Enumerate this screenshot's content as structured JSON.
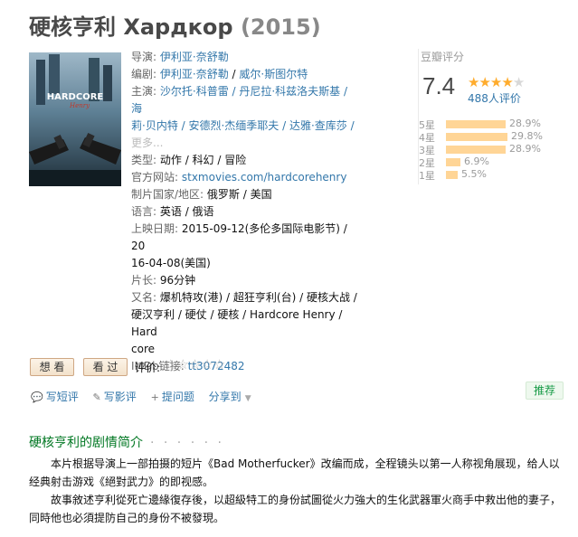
{
  "title": {
    "name": "硬核亨利 Хардкор",
    "year": "(2015)"
  },
  "poster": {
    "line1": "HARDCORE",
    "line2": "Henry"
  },
  "info": {
    "director_label": "导演:",
    "director": "伊利亚·奈舒勒",
    "writer_label": "编剧:",
    "writers": [
      "伊利亚·奈舒勒",
      "威尔·斯图尔特"
    ],
    "cast_label": "主演:",
    "cast_line1": "沙尔托·科普雷 / 丹尼拉·科兹洛夫斯基 / 海",
    "cast_line2": "莉·贝内特 / 安德烈·杰缅季耶夫 / 达雅·查库莎 /",
    "cast_more": "更多...",
    "genre_label": "类型:",
    "genres": "动作 / 科幻 / 冒险",
    "site_label": "官方网站:",
    "site": "stxmovies.com/hardcorehenry",
    "country_label": "制片国家/地区:",
    "country": "俄罗斯 / 美国",
    "language_label": "语言:",
    "language": "英语 / 俄语",
    "release_label": "上映日期:",
    "release_line1": "2015-09-12(多伦多国际电影节) / 20",
    "release_line2": "16-04-08(美国)",
    "runtime_label": "片长:",
    "runtime": "96分钟",
    "aka_label": "又名:",
    "aka_line1": "爆机特攻(港) / 超狂亨利(台) / 硬核大战 /",
    "aka_line2": "硬汉亨利 / 硬仗 / 硬核 / Hardcore Henry / Hard",
    "aka_line3": "core",
    "imdb_label": "IMDb链接:",
    "imdb": "tt3072482"
  },
  "rating": {
    "header": "豆瓣评分",
    "score": "7.4",
    "stars_on": 4,
    "votes": "488人评价",
    "distribution": [
      {
        "label": "5星",
        "pct": "28.9%",
        "value": 28.9
      },
      {
        "label": "4星",
        "pct": "29.8%",
        "value": 29.8
      },
      {
        "label": "3星",
        "pct": "28.9%",
        "value": 28.9
      },
      {
        "label": "2星",
        "pct": "6.9%",
        "value": 6.9
      },
      {
        "label": "1星",
        "pct": "5.5%",
        "value": 5.5
      }
    ]
  },
  "buttons": {
    "want": "想 看",
    "seen": "看 过"
  },
  "rate_label": "评价:",
  "actions": {
    "short_review": "写短评",
    "review": "写影评",
    "question": "提问题",
    "share": "分享到"
  },
  "recommend": "推荐",
  "synopsis": {
    "heading": "硬核亨利的剧情简介",
    "dots": "· · · · · ·",
    "p1": "本片根据导演上一部拍摄的短片《Bad Motherfucker》改编而成，全程镜头以第一人称视角展现，给人以经典射击游戏《絕對武力》的即视感。",
    "p2": "故事敘述亨利從死亡邊緣復存後，以超級特工的身份試圖從火力強大的生化武器軍火商手中救出他的妻子，同時他也必須提防自己的身份不被發現。"
  },
  "colors": {
    "link": "#3377aa",
    "star": "#ffac2d",
    "bar": "#ffd596",
    "green": "#007722"
  }
}
